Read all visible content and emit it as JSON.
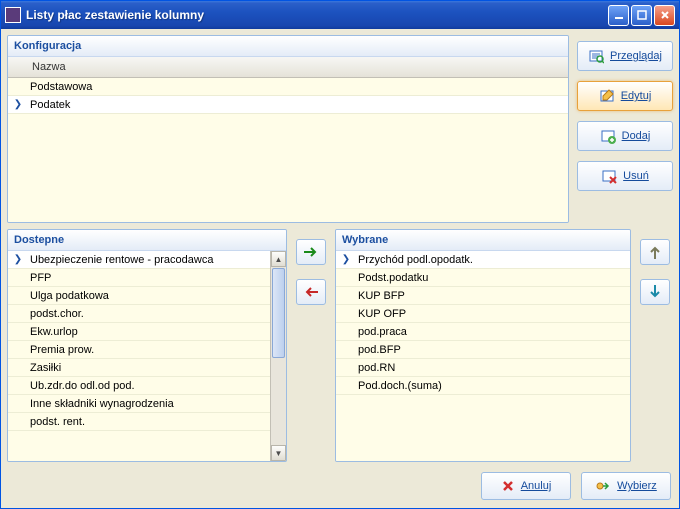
{
  "window": {
    "title": "Listy płac zestawienie kolumny"
  },
  "config": {
    "header": "Konfiguracja",
    "column_header": "Nazwa",
    "rows": [
      "Podstawowa",
      "Podatek"
    ],
    "selected_index": 1
  },
  "side_buttons": {
    "browse": "Przeglądaj",
    "edit": "Edytuj",
    "add": "Dodaj",
    "delete": "Usuń"
  },
  "available": {
    "header": "Dostepne",
    "items": [
      "Ubezpieczenie rentowe - pracodawca",
      "PFP",
      "Ulga podatkowa",
      "podst.chor.",
      "Ekw.urlop",
      "Premia prow.",
      "Zasiłki",
      "Ub.zdr.do odl.od pod.",
      "Inne składniki wynagrodzenia",
      "podst. rent."
    ],
    "selected_index": 0
  },
  "chosen": {
    "header": "Wybrane",
    "items": [
      "Przychód podl.opodatk.",
      "Podst.podatku",
      "KUP BFP",
      "KUP OFP",
      "pod.praca",
      "pod.BFP",
      "pod.RN",
      "Pod.doch.(suma)"
    ],
    "selected_index": 0
  },
  "bottom": {
    "cancel": "Anuluj",
    "select": "Wybierz"
  }
}
